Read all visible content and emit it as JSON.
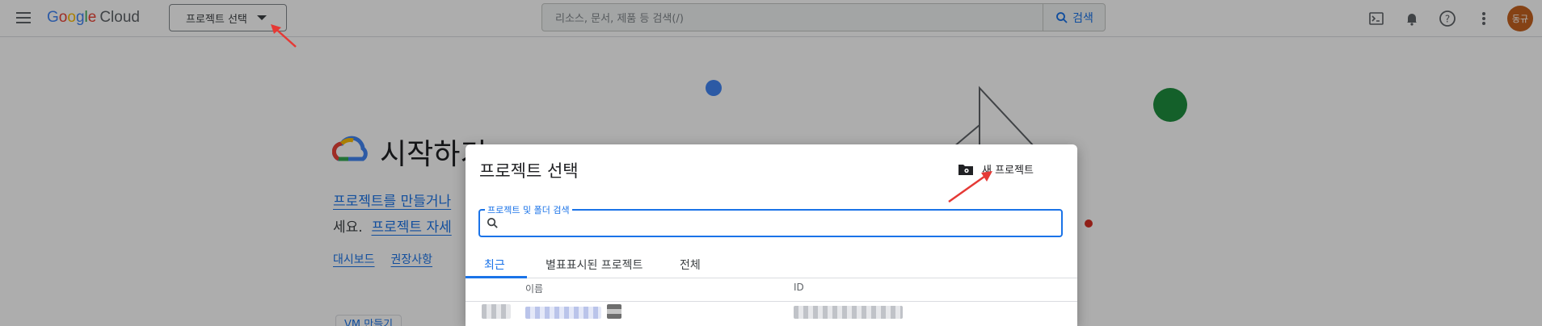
{
  "header": {
    "logo_google": [
      "G",
      "o",
      "o",
      "g",
      "l",
      "e"
    ],
    "logo_cloud": "Cloud",
    "project_picker_label": "프로젝트 선택",
    "search_placeholder": "리소스, 문서, 제품 등 검색(/)",
    "search_button_label": "검색",
    "avatar_text": "동규"
  },
  "background": {
    "title": "시작하기",
    "intro_line1": "프로젝트를 만들거나",
    "intro_line2_prefix": "세요.",
    "intro_line2_link": "프로젝트 자세",
    "links": [
      "대시보드",
      "권장사항"
    ],
    "vm_button": "VM 만들기"
  },
  "dialog": {
    "title": "프로젝트 선택",
    "new_project_label": "새 프로젝트",
    "search_label": "프로젝트 및 폴더 검색",
    "tabs": [
      "최근",
      "별표표시된 프로젝트",
      "전체"
    ],
    "active_tab": "최근",
    "columns": {
      "name": "이름",
      "id": "ID"
    }
  },
  "colors": {
    "accent": "#1a73e8",
    "avatar": "#c5621f",
    "annotation_arrow": "#e53935"
  },
  "icons": [
    "menu-icon",
    "caret-down-icon",
    "search-icon",
    "terminal-icon",
    "bell-icon",
    "help-icon",
    "more-vert-icon",
    "folder-settings-icon",
    "google-cloud-logo-icon"
  ]
}
